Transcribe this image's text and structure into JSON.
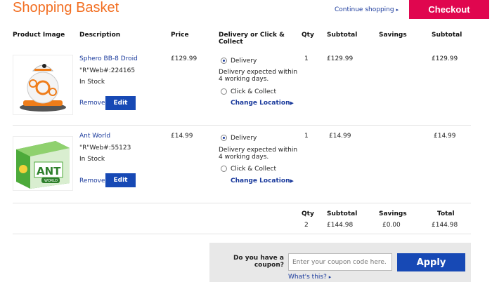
{
  "header": {
    "title": "Shopping Basket",
    "continue_label": "Continue shopping",
    "continue_arrow": "▸",
    "checkout_label": "Checkout"
  },
  "columns": {
    "product_image": "Product Image",
    "description": "Description",
    "price": "Price",
    "delivery": "Delivery or Click & Collect",
    "qty": "Qty",
    "subtotal": "Subtotal",
    "savings": "Savings",
    "subtotal2": "Subtotal"
  },
  "items": [
    {
      "name": "Sphero BB-8 Droid",
      "code": "\"R\"Web#:224165",
      "stock": "In Stock",
      "remove": "Remove",
      "edit": "Edit",
      "price": "£129.99",
      "delivery_label": "Delivery",
      "delivery_note": "Delivery expected within 4 working days.",
      "collect_label": "Click & Collect",
      "change_location": "Change Location",
      "change_arrow": "▶",
      "qty": "1",
      "subtotal": "£129.99",
      "savings": "",
      "total": "£129.99"
    },
    {
      "name": "Ant World",
      "code": "\"R\"Web#:55123",
      "stock": "In Stock",
      "remove": "Remove",
      "edit": "Edit",
      "price": "£14.99",
      "delivery_label": "Delivery",
      "delivery_note": "Delivery expected within 4 working days.",
      "collect_label": "Click & Collect",
      "change_location": "Change Location",
      "change_arrow": "▶",
      "qty": "1",
      "subtotal": "£14.99",
      "savings": "",
      "total": "£14.99"
    }
  ],
  "totals": {
    "qty_label": "Qty",
    "subtotal_label": "Subtotal",
    "savings_label": "Savings",
    "total_label": "Total",
    "qty": "2",
    "subtotal": "£144.98",
    "savings": "£0.00",
    "total": "£144.98"
  },
  "coupon": {
    "question": "Do you have a coupon?",
    "placeholder": "Enter your coupon code here.",
    "apply_label": "Apply",
    "whats_this": "What's this?",
    "whats_arrow": "▸"
  },
  "colors": {
    "title": "#f26e21",
    "checkout": "#e0064f",
    "primary_button": "#1749b5",
    "link": "#1a3a9c"
  }
}
